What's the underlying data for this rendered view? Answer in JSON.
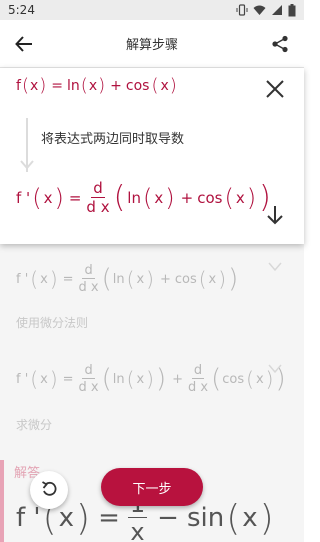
{
  "status_bar": {
    "time": "5:24",
    "icons": [
      "vibrate-icon",
      "wifi-icon",
      "signal-icon",
      "battery-icon"
    ]
  },
  "app_bar": {
    "title": "解算步骤",
    "back_icon": "back-arrow-icon",
    "share_icon": "share-icon"
  },
  "current_step": {
    "equation": {
      "f": "f",
      "x": "x",
      "eq": "=",
      "ln": "ln",
      "plus": "+",
      "cos": "cos"
    },
    "description": "将表达式两边同时取导数",
    "result": {
      "fprime": "f '",
      "x": "x",
      "eq": "=",
      "d": "d",
      "dx": "d x",
      "ln": "ln",
      "plus": "+",
      "cos": "cos"
    }
  },
  "faded_steps": [
    {
      "fprime": "f '",
      "x": "x",
      "eq": "=",
      "d": "d",
      "dx": "d x",
      "ln": "ln",
      "plus": "+",
      "cos": "cos",
      "label": "使用微分法则"
    },
    {
      "fprime": "f '",
      "x": "x",
      "eq": "=",
      "d": "d",
      "dx": "d x",
      "ln": "ln",
      "plus": "+",
      "cos": "cos",
      "label": "求微分"
    }
  ],
  "answer": {
    "label": "解答",
    "fprime": "f '",
    "x": "x",
    "eq": "=",
    "num": "1",
    "den": "x",
    "minus": "−",
    "sin": "sin"
  },
  "buttons": {
    "next": "下一步"
  },
  "colors": {
    "accent": "#b8123e",
    "equation": "#b0123f",
    "faded": "#b8b8b8"
  }
}
